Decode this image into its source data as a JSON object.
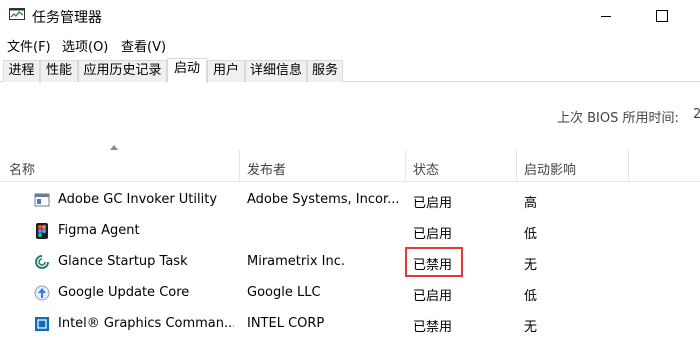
{
  "window": {
    "title": "任务管理器",
    "menu": [
      "文件(F)",
      "选项(O)",
      "查看(V)"
    ],
    "tabs": [
      "进程",
      "性能",
      "应用历史记录",
      "启动",
      "用户",
      "详细信息",
      "服务"
    ],
    "active_tab": "启动"
  },
  "startup": {
    "bios_label": "上次 BIOS 所用时间:",
    "bios_value": "2",
    "columns": {
      "name": "名称",
      "publisher": "发布者",
      "status": "状态",
      "impact": "启动影响"
    },
    "rows": [
      {
        "name": "Adobe GC Invoker Utility",
        "publisher": "Adobe Systems, Incor...",
        "status": "已启用",
        "impact": "高",
        "icon": "adobe-gc-icon"
      },
      {
        "name": "Figma Agent",
        "publisher": "",
        "status": "已启用",
        "impact": "低",
        "icon": "figma-icon"
      },
      {
        "name": "Glance Startup Task",
        "publisher": "Mirametrix Inc.",
        "status": "已禁用",
        "impact": "无",
        "icon": "glance-icon"
      },
      {
        "name": "Google Update Core",
        "publisher": "Google LLC",
        "status": "已启用",
        "impact": "低",
        "icon": "google-update-icon"
      },
      {
        "name": "Intel® Graphics Comman...",
        "publisher": "INTEL CORP",
        "status": "已禁用",
        "impact": "无",
        "icon": "intel-graphics-icon"
      }
    ]
  },
  "colors": {
    "highlight": "#e23a3a",
    "header_text": "#444444",
    "tab_bg": "#f0f0f0"
  }
}
